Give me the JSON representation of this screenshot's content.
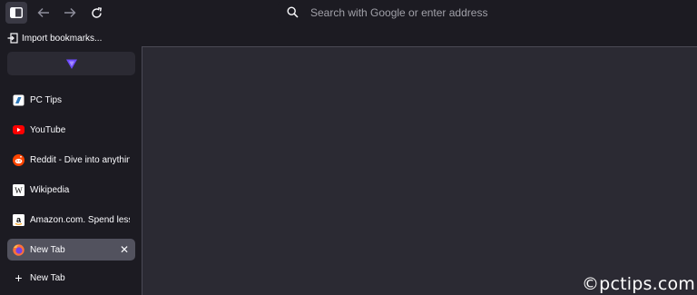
{
  "toolbar": {
    "buttons": [
      {
        "name": "sidebar-toggle",
        "icon": "sidebar-icon"
      },
      {
        "name": "back",
        "icon": "arrow-left-icon"
      },
      {
        "name": "forward",
        "icon": "arrow-right-icon"
      },
      {
        "name": "reload",
        "icon": "reload-icon"
      }
    ]
  },
  "urlbar": {
    "placeholder": "Search with Google or enter address",
    "icon": "search-icon"
  },
  "sidebar": {
    "import_label": "Import bookmarks...",
    "extension_icon": "proton-vpn-icon",
    "tabs": [
      {
        "label": "PC Tips",
        "icon": "pctips-icon"
      },
      {
        "label": "YouTube",
        "icon": "youtube-icon"
      },
      {
        "label": "Reddit - Dive into anythin",
        "icon": "reddit-icon"
      },
      {
        "label": "Wikipedia",
        "icon": "wikipedia-icon"
      },
      {
        "label": "Amazon.com. Spend less.",
        "icon": "amazon-icon"
      },
      {
        "label": "New Tab",
        "icon": "firefox-icon",
        "selected": true,
        "close": "✕"
      }
    ],
    "new_tab_label": "New Tab",
    "new_tab_icon": "+"
  },
  "watermark": "©pctips.com",
  "colors": {
    "background": "#1c1b22",
    "content": "#2b2a33",
    "selected_tab": "#52525e",
    "accent_youtube": "#ff0000",
    "accent_reddit": "#ff4500"
  }
}
